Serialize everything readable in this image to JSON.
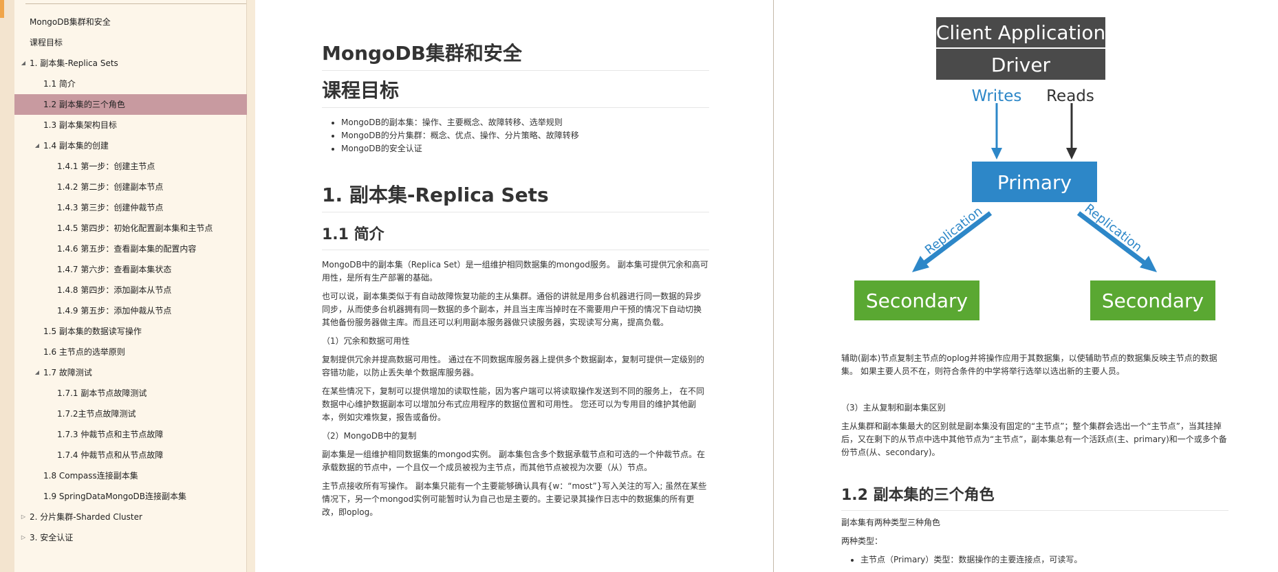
{
  "toc": {
    "items": [
      {
        "label": "MongoDB集群和安全",
        "level": 1,
        "arrow": "",
        "active": false
      },
      {
        "label": "课程目标",
        "level": 1,
        "arrow": "",
        "active": false
      },
      {
        "label": "1. 副本集-Replica Sets",
        "level": 1,
        "arrow": "◢",
        "active": false
      },
      {
        "label": "1.1 简介",
        "level": 2,
        "arrow": "",
        "active": false
      },
      {
        "label": "1.2 副本集的三个角色",
        "level": 2,
        "arrow": "",
        "active": true
      },
      {
        "label": "1.3 副本集架构目标",
        "level": 2,
        "arrow": "",
        "active": false
      },
      {
        "label": "1.4 副本集的创建",
        "level": 2,
        "arrow": "◢",
        "active": false
      },
      {
        "label": "1.4.1 第一步：创建主节点",
        "level": 3,
        "arrow": "",
        "active": false
      },
      {
        "label": "1.4.2 第二步：创建副本节点",
        "level": 3,
        "arrow": "",
        "active": false
      },
      {
        "label": "1.4.3 第三步：创建仲裁节点",
        "level": 3,
        "arrow": "",
        "active": false
      },
      {
        "label": "1.4.5 第四步：初始化配置副本集和主节点",
        "level": 3,
        "arrow": "",
        "active": false
      },
      {
        "label": "1.4.6 第五步：查看副本集的配置内容",
        "level": 3,
        "arrow": "",
        "active": false
      },
      {
        "label": "1.4.7 第六步：查看副本集状态",
        "level": 3,
        "arrow": "",
        "active": false
      },
      {
        "label": "1.4.8 第四步：添加副本从节点",
        "level": 3,
        "arrow": "",
        "active": false
      },
      {
        "label": "1.4.9 第五步：添加仲裁从节点",
        "level": 3,
        "arrow": "",
        "active": false
      },
      {
        "label": "1.5 副本集的数据读写操作",
        "level": 2,
        "arrow": "",
        "active": false
      },
      {
        "label": "1.6 主节点的选举原则",
        "level": 2,
        "arrow": "",
        "active": false
      },
      {
        "label": "1.7 故障测试",
        "level": 2,
        "arrow": "◢",
        "active": false
      },
      {
        "label": "1.7.1 副本节点故障测试",
        "level": 3,
        "arrow": "",
        "active": false
      },
      {
        "label": "1.7.2主节点故障测试",
        "level": 3,
        "arrow": "",
        "active": false
      },
      {
        "label": "1.7.3 仲裁节点和主节点故障",
        "level": 3,
        "arrow": "",
        "active": false
      },
      {
        "label": "1.7.4 仲裁节点和从节点故障",
        "level": 3,
        "arrow": "",
        "active": false
      },
      {
        "label": "1.8 Compass连接副本集",
        "level": 2,
        "arrow": "",
        "active": false
      },
      {
        "label": "1.9 SpringDataMongoDB连接副本集",
        "level": 2,
        "arrow": "",
        "active": false
      },
      {
        "label": "2. 分片集群-Sharded Cluster",
        "level": 1,
        "arrow": "▷",
        "active": false
      },
      {
        "label": "3. 安全认证",
        "level": 1,
        "arrow": "▷",
        "active": false
      }
    ]
  },
  "page1": {
    "title": "MongoDB集群和安全",
    "goals_heading": "课程目标",
    "goals": [
      "MongoDB的副本集：操作、主要概念、故障转移、选举规则",
      "MongoDB的分片集群：概念、优点、操作、分片策略、故障转移",
      "MongoDB的安全认证"
    ],
    "section1_heading": "1. 副本集-Replica Sets",
    "intro_heading": "1.1 简介",
    "p1": "MongoDB中的副本集（Replica Set）是一组维护相同数据集的mongod服务。 副本集可提供冗余和高可用性，是所有生产部署的基础。",
    "p2": "也可以说，副本集类似于有自动故障恢复功能的主从集群。通俗的讲就是用多台机器进行同一数据的异步同步，从而使多台机器拥有同一数据的多个副本，并且当主库当掉时在不需要用户干预的情况下自动切换其他备份服务器做主库。而且还可以利用副本服务器做只读服务器，实现读写分离，提高负载。",
    "sub1": "（1）冗余和数据可用性",
    "p3": "复制提供冗余并提高数据可用性。 通过在不同数据库服务器上提供多个数据副本，复制可提供一定级别的容错功能，以防止丢失单个数据库服务器。",
    "p4": "在某些情况下，复制可以提供增加的读取性能，因为客户端可以将读取操作发送到不同的服务上， 在不同数据中心维护数据副本可以增加分布式应用程序的数据位置和可用性。 您还可以为专用目的维护其他副本，例如灾难恢复，报告或备份。",
    "sub2": "（2）MongoDB中的复制",
    "p5": "副本集是一组维护相同数据集的mongod实例。 副本集包含多个数据承载节点和可选的一个仲裁节点。在承载数据的节点中，一个且仅一个成员被视为主节点，而其他节点被视为次要（从）节点。",
    "p6": "主节点接收所有写操作。 副本集只能有一个主要能够确认具有{w：“most”}写入关注的写入; 虽然在某些情况下，另一个mongod实例可能暂时认为自己也是主要的。主要记录其操作日志中的数据集的所有更改，即oplog。"
  },
  "diagram": {
    "client_label": "Client Application",
    "driver_label": "Driver",
    "writes_label": "Writes",
    "reads_label": "Reads",
    "primary_label": "Primary",
    "replication_left": "Replication",
    "replication_right": "Replication",
    "secondary_left": "Secondary",
    "secondary_right": "Secondary",
    "colors": {
      "dark": "#4a4a4a",
      "blue": "#2d87c8",
      "green": "#5aa832",
      "arrow_dark": "#333333"
    }
  },
  "page2": {
    "p1": "辅助(副本)节点复制主节点的oplog并将操作应用于其数据集，以使辅助节点的数据集反映主节点的数据集。 如果主要人员不在，则符合条件的中学将举行选举以选出新的主要人员。",
    "sub3": "（3）主从复制和副本集区别",
    "p2": "主从集群和副本集最大的区别就是副本集没有固定的“主节点”；整个集群会选出一个“主节点”，当其挂掉后，又在剩下的从节点中选中其他节点为“主节点”，副本集总有一个活跃点(主、primary)和一个或多个备份节点(从、secondary)。",
    "roles_heading": "1.2 副本集的三个角色",
    "p3": "副本集有两种类型三种角色",
    "p4": "两种类型：",
    "bullet1": "主节点（Primary）类型：数据操作的主要连接点，可读写。"
  }
}
